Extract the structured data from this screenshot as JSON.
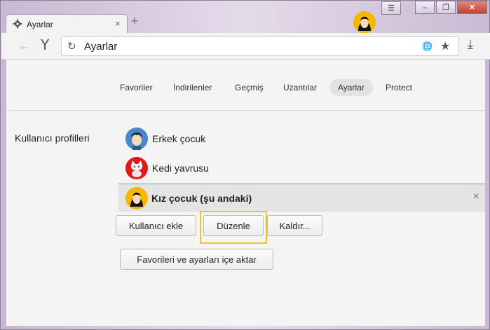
{
  "tab": {
    "title": "Ayarlar",
    "close": "×",
    "new_tab": "+"
  },
  "window": {
    "menu": "☰",
    "minimize": "–",
    "maximize": "❐",
    "close": "✕"
  },
  "toolbar": {
    "back": "←",
    "logo": "Y",
    "reload": "↻",
    "address": "Ayarlar",
    "globe": "🌐",
    "star": "★",
    "download": "⤓"
  },
  "nav": {
    "items": [
      {
        "label": "Favoriler",
        "active": false
      },
      {
        "label": "İndirilenler",
        "active": false
      },
      {
        "label": "Geçmiş",
        "active": false
      },
      {
        "label": "Uzantılar",
        "active": false
      },
      {
        "label": "Ayarlar",
        "active": true
      },
      {
        "label": "Protect",
        "active": false
      }
    ]
  },
  "profiles": {
    "section_label": "Kullanıcı profilleri",
    "list": [
      {
        "name": "Erkek çocuk",
        "avatar": "boy-avatar"
      },
      {
        "name": "Kedi yavrusu",
        "avatar": "cat-avatar"
      }
    ],
    "current": {
      "name": "Kız çocuk (şu andaki)",
      "avatar": "girl-avatar",
      "remove": "×"
    },
    "buttons": {
      "add": "Kullanıcı ekle",
      "edit": "Düzenle",
      "remove": "Kaldır...",
      "import": "Favorileri ve ayarları içe aktar"
    }
  },
  "colors": {
    "focus_ring": "#f0c419",
    "accent_border": "#8e94b8"
  }
}
